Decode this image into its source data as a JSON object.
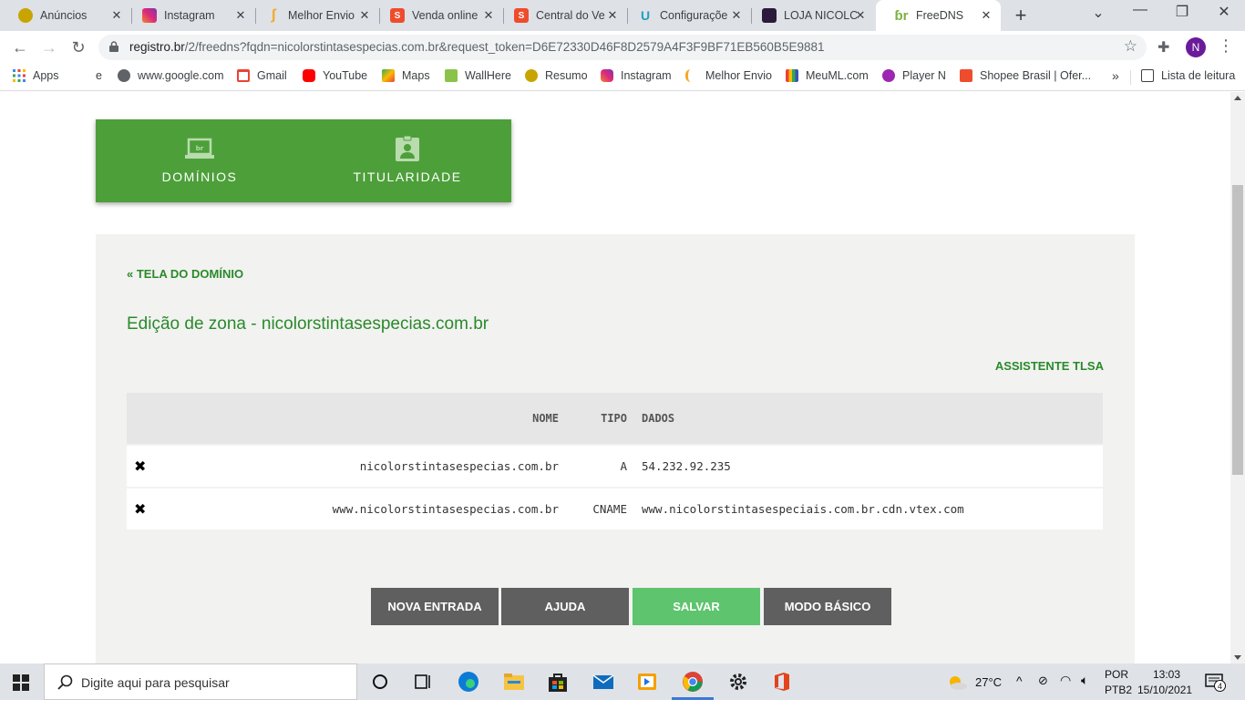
{
  "browser": {
    "tabs": [
      {
        "title": "Anúncios",
        "color": "#c9a400",
        "glyph": ""
      },
      {
        "title": "Instagram",
        "color": "#d6249f",
        "glyph": ""
      },
      {
        "title": "Melhor Envio",
        "color": "#f4a928",
        "glyph": ""
      },
      {
        "title": "Venda online",
        "color": "#ee4d2d",
        "glyph": "S"
      },
      {
        "title": "Central do Ve",
        "color": "#ee4d2d",
        "glyph": "S"
      },
      {
        "title": "Configuraçõe",
        "color": "#1ea0c3",
        "glyph": "U"
      },
      {
        "title": "LOJA NICOLO",
        "color": "#2b1a3c",
        "glyph": ""
      },
      {
        "title": "FreeDNS",
        "color": "#7cb342",
        "glyph": ""
      }
    ],
    "url_host": "registro.br",
    "url_rest": "/2/freedns?fqdn=nicolorstintasespecias.com.br&request_token=D6E72330D46F8D2579A4F3F9BF71EB560B5E9881",
    "profile_initial": "N",
    "bookmarks": [
      {
        "label": "Apps",
        "color": "#4285f4"
      },
      {
        "label": "e",
        "color": ""
      },
      {
        "label": "www.google.com",
        "color": "#5f6368"
      },
      {
        "label": "Gmail",
        "color": "#ea4335"
      },
      {
        "label": "YouTube",
        "color": "#ff0000"
      },
      {
        "label": "Maps",
        "color": "#34a853"
      },
      {
        "label": "WallHere",
        "color": "#8bc34a"
      },
      {
        "label": "Resumo",
        "color": "#c9a400"
      },
      {
        "label": "Instagram",
        "color": "#d6249f"
      },
      {
        "label": "Melhor Envio",
        "color": "#f4a928"
      },
      {
        "label": "MeuML.com",
        "color": "#3f51b5"
      },
      {
        "label": "Player N",
        "color": "#9c27b0"
      },
      {
        "label": "Shopee Brasil | Ofer...",
        "color": "#ee4d2d"
      }
    ],
    "reading_list": "Lista de leitura"
  },
  "page": {
    "nav": {
      "domains_label": "DOMÍNIOS",
      "ownership_label": "TITULARIDADE"
    },
    "back_link": "« TELA DO DOMÍNIO",
    "zone_title": "Edição de zona - nicolorstintasespecias.com.br",
    "tlsa_link": "ASSISTENTE TLSA",
    "table": {
      "headers": {
        "name": "NOME",
        "type": "TIPO",
        "data": "DADOS"
      },
      "rows": [
        {
          "name": "nicolorstintasespecias.com.br",
          "type": "A",
          "data": "54.232.92.235"
        },
        {
          "name": "www.nicolorstintasespecias.com.br",
          "type": "CNAME",
          "data": "www.nicolorstintasespeciais.com.br.cdn.vtex.com"
        }
      ]
    },
    "buttons": {
      "new_entry": "NOVA ENTRADA",
      "help": "AJUDA",
      "save": "SALVAR",
      "basic_mode": "MODO BÁSICO"
    }
  },
  "taskbar": {
    "search_placeholder": "Digite aqui para pesquisar",
    "temperature": "27°C",
    "lang_top": "POR",
    "lang_bottom": "PTB2",
    "time": "13:03",
    "date": "15/10/2021",
    "notifications": "4"
  }
}
